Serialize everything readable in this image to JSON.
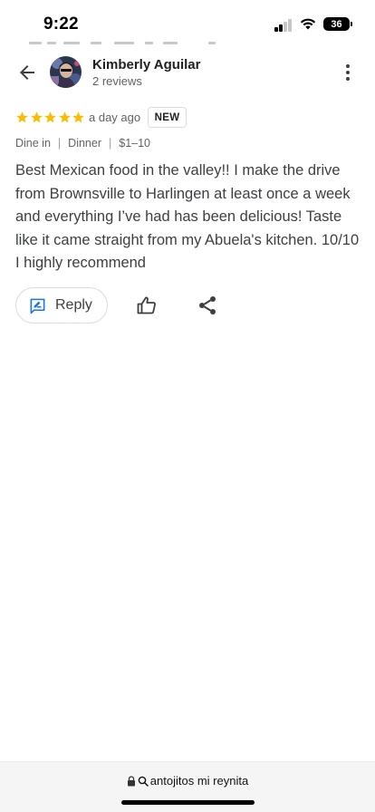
{
  "status_bar": {
    "time": "9:22",
    "battery": "36"
  },
  "header": {
    "reviewer_name": "Kimberly Aguilar",
    "review_count": "2 reviews"
  },
  "review": {
    "rating": 5,
    "max_rating": 5,
    "star_color": "#fbbc04",
    "time_ago": "a day ago",
    "badge": "NEW",
    "meta": [
      "Dine in",
      "Dinner",
      "$1–10"
    ],
    "meta_separator": "|",
    "text": "Best Mexican food in the valley!! I make the drive from Brownsville to Harlingen at least once a week and everything I’ve had has been delicious! Taste like it came straight from my Abuela's kitchen. 10/10 I highly recommend"
  },
  "actions": {
    "reply_label": "Reply",
    "reply_icon": "rate-review-icon",
    "like_icon": "thumb-up-icon",
    "share_icon": "share-icon"
  },
  "browser": {
    "url": "antojitos mi reynita"
  },
  "colors": {
    "accent": "#1a73e8",
    "text_primary": "#202124",
    "text_secondary": "#5f6368"
  }
}
